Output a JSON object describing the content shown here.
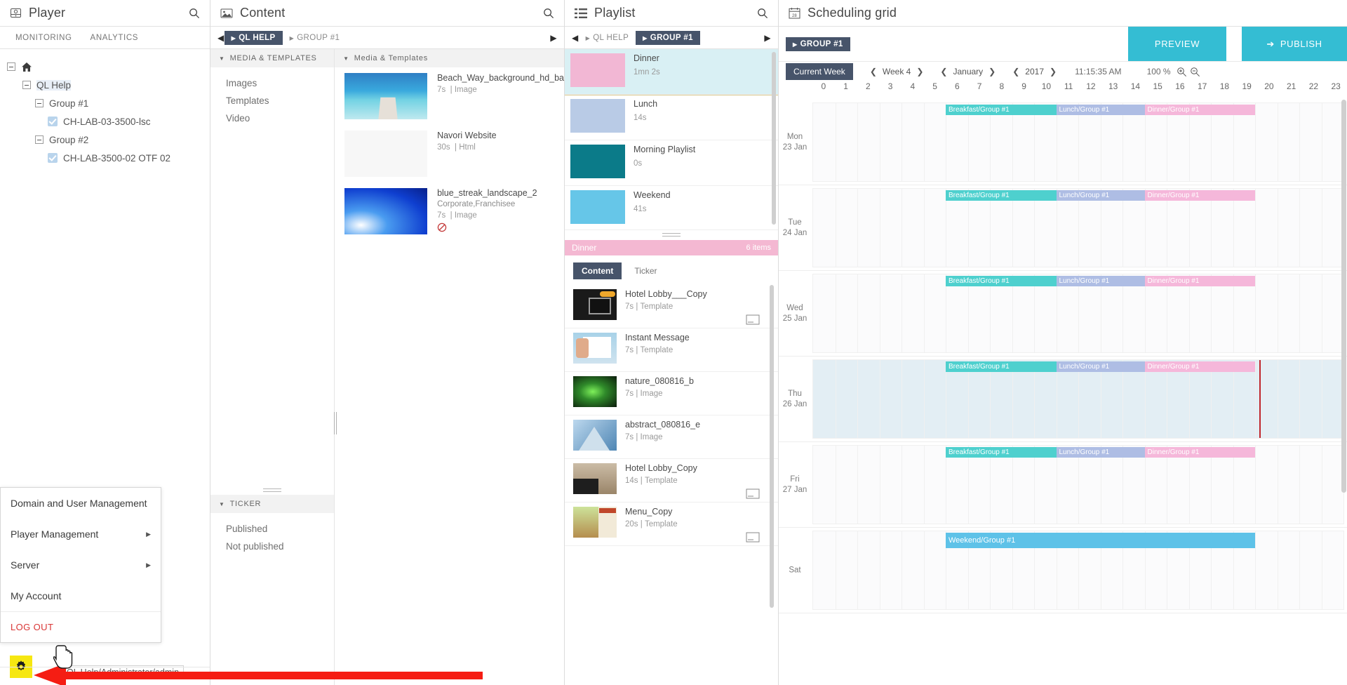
{
  "player": {
    "title": "Player",
    "icon": "player-icon",
    "search_icon": "search-icon",
    "tabs": [
      {
        "label": "MONITORING"
      },
      {
        "label": "ANALYTICS"
      }
    ],
    "tree": [
      {
        "label": "",
        "icon": "home-icon",
        "level": 0,
        "type": "root"
      },
      {
        "label": "QL Help",
        "level": 1,
        "type": "group",
        "selected": true
      },
      {
        "label": "Group #1",
        "level": 2,
        "type": "group"
      },
      {
        "label": "CH-LAB-03-3500-lsc",
        "level": 3,
        "type": "player"
      },
      {
        "label": "Group #2",
        "level": 2,
        "type": "group"
      },
      {
        "label": "CH-LAB-3500-02 OTF 02",
        "level": 3,
        "type": "player"
      }
    ],
    "context_menu": [
      {
        "label": "Domain and User Management",
        "submenu": false
      },
      {
        "label": "Player Management",
        "submenu": true
      },
      {
        "label": "Server",
        "submenu": true
      },
      {
        "label": "My Account",
        "submenu": false
      },
      {
        "label": "LOG OUT",
        "submenu": false,
        "danger": true
      }
    ],
    "gear_icon": "gear-icon",
    "status_label": "QL Help/Administrator/admin"
  },
  "content": {
    "title": "Content",
    "icon": "content-icon",
    "search_icon": "search-icon",
    "breadcrumb": {
      "prev_icon": "arrow-left-icon",
      "next_icon": "arrow-right-icon",
      "items": [
        {
          "label": "QL HELP",
          "active": true
        },
        {
          "label": "GROUP #1",
          "active": false
        }
      ]
    },
    "sections": [
      {
        "title": "MEDIA & TEMPLATES",
        "items": [
          {
            "label": "Images"
          },
          {
            "label": "Templates"
          },
          {
            "label": "Video"
          }
        ]
      },
      {
        "title": "TICKER",
        "items": [
          {
            "label": "Published"
          },
          {
            "label": "Not published"
          }
        ]
      }
    ],
    "media_header": "Media & Templates",
    "media": [
      {
        "name": "Beach_Way_background_hd_ba",
        "duration": "7s",
        "kind": "Image",
        "sub": "",
        "color": "#3aa8d8",
        "flag": false
      },
      {
        "name": "Navori Website",
        "duration": "30s",
        "kind": "Html",
        "sub": "",
        "color": "#f4f4f4",
        "flag": false
      },
      {
        "name": "blue_streak_landscape_2",
        "duration": "7s",
        "kind": "Image",
        "sub": "Corporate,Franchisee",
        "color": "#1056d2",
        "flag": true
      }
    ]
  },
  "playlist": {
    "title": "Playlist",
    "icon": "list-icon",
    "search_icon": "search-icon",
    "breadcrumb": {
      "prev_icon": "arrow-left-icon",
      "next_icon": "arrow-right-icon",
      "items": [
        {
          "label": "QL HELP",
          "active": false
        },
        {
          "label": "GROUP #1",
          "active": true
        }
      ]
    },
    "playlists": [
      {
        "name": "Dinner",
        "duration": "1mn 2s",
        "color": "#f2b7d4",
        "selected": true
      },
      {
        "name": "Lunch",
        "duration": "14s",
        "color": "#b9cbe6",
        "selected": false
      },
      {
        "name": "Morning Playlist",
        "duration": "0s",
        "color": "#0b7b89",
        "selected": false
      },
      {
        "name": "Weekend",
        "duration": "41s",
        "color": "#66c6e8",
        "selected": false
      }
    ],
    "selected_bar": {
      "name": "Dinner",
      "count": "6 items"
    },
    "tabs": [
      {
        "label": "Content",
        "active": true
      },
      {
        "label": "Ticker",
        "active": false
      }
    ],
    "items": [
      {
        "name": "Hotel Lobby___Copy",
        "duration": "7s",
        "kind": "Template",
        "color": "#232323",
        "badge": true
      },
      {
        "name": "Instant Message",
        "duration": "7s",
        "kind": "Template",
        "color": "#9dc7e0",
        "badge": false
      },
      {
        "name": "nature_080816_b",
        "duration": "7s",
        "kind": "Image",
        "color": "#1d3b18",
        "badge": false
      },
      {
        "name": "abstract_080816_e",
        "duration": "7s",
        "kind": "Image",
        "color": "#7fa8c9",
        "badge": false
      },
      {
        "name": "Hotel Lobby_Copy",
        "duration": "14s",
        "kind": "Template",
        "color": "#8a7a62",
        "badge": true
      },
      {
        "name": "Menu_Copy",
        "duration": "20s",
        "kind": "Template",
        "color": "#b8cc84",
        "badge": true
      }
    ]
  },
  "schedule": {
    "title": "Scheduling grid",
    "icon": "calendar-icon",
    "breadcrumb": [
      {
        "label": "GROUP #1",
        "active": true
      }
    ],
    "preview_label": "PREVIEW",
    "publish_label": "PUBLISH",
    "publish_icon": "arrow-right-icon",
    "current_week_label": "Current Week",
    "week": "Week 4",
    "month": "January",
    "year": "2017",
    "clock": "11:15:35 AM",
    "zoom": "100 %",
    "zoom_in_icon": "zoom-in-icon",
    "zoom_out_icon": "zoom-out-icon",
    "hours": [
      "0",
      "1",
      "2",
      "3",
      "4",
      "5",
      "6",
      "7",
      "8",
      "9",
      "10",
      "11",
      "12",
      "13",
      "14",
      "15",
      "16",
      "17",
      "18",
      "19",
      "20",
      "21",
      "22",
      "23"
    ],
    "now_hour": 20.2,
    "days": [
      {
        "dow": "Mon",
        "date": "23 Jan",
        "selected": false,
        "events": [
          {
            "label": "Breakfast/Group #1",
            "start": 6,
            "end": 11,
            "color": "#4ed0ce"
          },
          {
            "label": "Lunch/Group #1",
            "start": 11,
            "end": 15,
            "color": "#aebde4"
          },
          {
            "label": "Dinner/Group #1",
            "start": 15,
            "end": 20,
            "color": "#f5b7da"
          }
        ]
      },
      {
        "dow": "Tue",
        "date": "24 Jan",
        "selected": false,
        "events": [
          {
            "label": "Breakfast/Group #1",
            "start": 6,
            "end": 11,
            "color": "#4ed0ce"
          },
          {
            "label": "Lunch/Group #1",
            "start": 11,
            "end": 15,
            "color": "#aebde4"
          },
          {
            "label": "Dinner/Group #1",
            "start": 15,
            "end": 20,
            "color": "#f5b7da"
          }
        ]
      },
      {
        "dow": "Wed",
        "date": "25 Jan",
        "selected": false,
        "events": [
          {
            "label": "Breakfast/Group #1",
            "start": 6,
            "end": 11,
            "color": "#4ed0ce"
          },
          {
            "label": "Lunch/Group #1",
            "start": 11,
            "end": 15,
            "color": "#aebde4"
          },
          {
            "label": "Dinner/Group #1",
            "start": 15,
            "end": 20,
            "color": "#f5b7da"
          }
        ]
      },
      {
        "dow": "Thu",
        "date": "26 Jan",
        "selected": true,
        "events": [
          {
            "label": "Breakfast/Group #1",
            "start": 6,
            "end": 11,
            "color": "#4ed0ce"
          },
          {
            "label": "Lunch/Group #1",
            "start": 11,
            "end": 15,
            "color": "#aebde4"
          },
          {
            "label": "Dinner/Group #1",
            "start": 15,
            "end": 20,
            "color": "#f5b7da"
          }
        ]
      },
      {
        "dow": "Fri",
        "date": "27 Jan",
        "selected": false,
        "events": [
          {
            "label": "Breakfast/Group #1",
            "start": 6,
            "end": 11,
            "color": "#4ed0ce"
          },
          {
            "label": "Lunch/Group #1",
            "start": 11,
            "end": 15,
            "color": "#aebde4"
          },
          {
            "label": "Dinner/Group #1",
            "start": 15,
            "end": 20,
            "color": "#f5b7da"
          }
        ]
      },
      {
        "dow": "Sat",
        "date": "",
        "selected": false,
        "events": [
          {
            "label": "Weekend/Group #1",
            "start": 6,
            "end": 20,
            "color": "#5ec2e8"
          }
        ]
      }
    ]
  }
}
